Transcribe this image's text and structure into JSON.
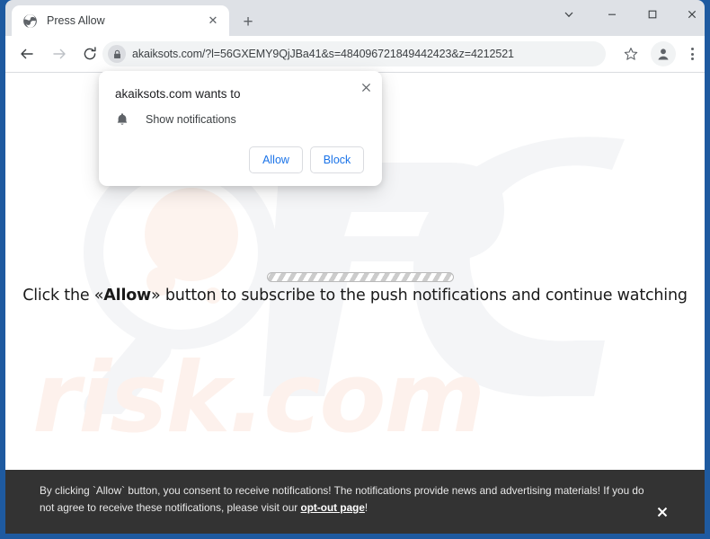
{
  "window": {
    "frame_color": "#1e5aa0",
    "controls": {
      "chevron_label": "⌄",
      "minimize_label": "—",
      "maximize_label": "□",
      "close_label": "✕"
    }
  },
  "tabstrip": {
    "tab": {
      "title": "Press Allow",
      "favicon_name": "globe-icon",
      "close_label": "✕"
    },
    "new_tab_label": "+"
  },
  "toolbar": {
    "back_label": "←",
    "forward_label": "→",
    "reload_label": "↻",
    "omnibox": {
      "url": "akaiksots.com/?l=56GXEMY9QjJBa41&s=484096721849442423&z=4212521",
      "lock_icon_name": "lock-icon"
    },
    "bookmark_label": "☆",
    "menu_name": "three-dot-menu"
  },
  "permission_bubble": {
    "title": "akaiksots.com wants to",
    "permission_label": "Show notifications",
    "permission_icon": "bell-icon",
    "allow_label": "Allow",
    "block_label": "Block",
    "close_label": "✕",
    "link_color": "#1a73e8"
  },
  "page": {
    "headline_before": "Click the «Allow»",
    "headline_bold": "Allow",
    "headline_prefix": "Click the «",
    "headline_suffix": "» button to subscribe to the push notifications and continue watching",
    "headline_full": "Click the «Allow» button to subscribe to the push notifications and continue watching",
    "progress_bar_name": "loading-progress-bar",
    "watermark_top": "PC",
    "watermark_bottom": "risk.com"
  },
  "consent_banner": {
    "text_part1": "By clicking `Allow` button, you consent to receive notifications! The notifications provide news and advertising materials! If you do not agree to receive these notifications, please visit our ",
    "link_text": "opt-out page",
    "text_part2": "!",
    "close_label": "✕",
    "background_color": "#333333"
  }
}
